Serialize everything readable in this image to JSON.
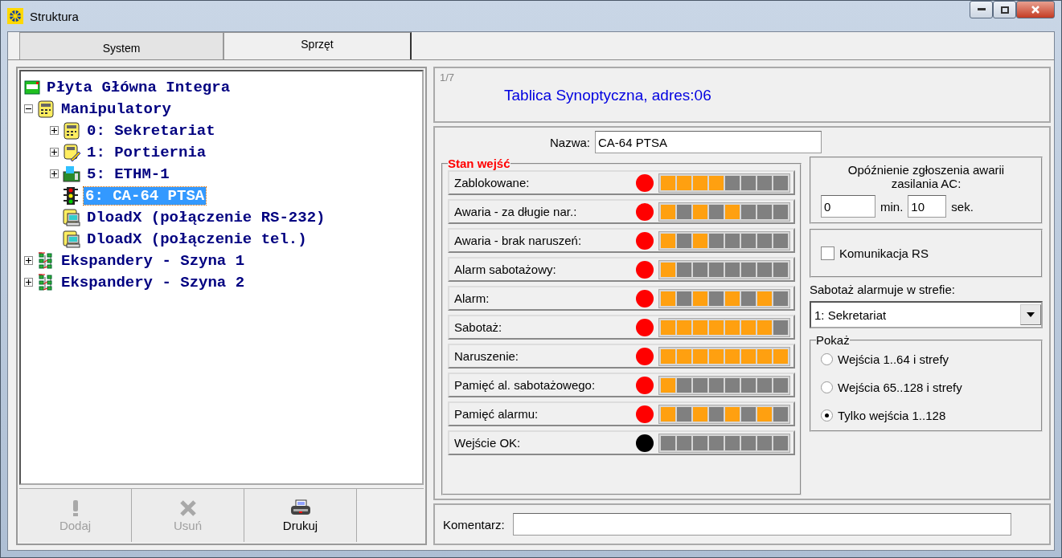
{
  "window": {
    "title": "Struktura"
  },
  "tabs": [
    {
      "label": "System",
      "selected": false
    },
    {
      "label": "Sprzęt",
      "selected": true
    }
  ],
  "tree": [
    {
      "label": "Płyta Główna Integra",
      "kind": "board",
      "selected": false
    },
    {
      "label": "Manipulatory",
      "kind": "keypad",
      "expanded": true,
      "selected": false,
      "children": [
        {
          "label": "0: Sekretariat",
          "kind": "keypad",
          "expanded": false,
          "selected": false
        },
        {
          "label": "1: Portiernia",
          "kind": "keypad-pen",
          "expanded": false,
          "selected": false
        },
        {
          "label": "5: ETHM-1",
          "kind": "network",
          "expanded": false,
          "selected": false
        },
        {
          "label": "6: CA-64 PTSA",
          "kind": "traffic",
          "selected": true
        },
        {
          "label": "DloadX (połączenie RS-232)",
          "kind": "computer",
          "selected": false
        },
        {
          "label": "DloadX (połączenie tel.)",
          "kind": "computer",
          "selected": false
        }
      ]
    },
    {
      "label": "Ekspandery - Szyna 1",
      "kind": "bus",
      "expanded": false,
      "selected": false
    },
    {
      "label": "Ekspandery - Szyna 2",
      "kind": "bus",
      "expanded": false,
      "selected": false
    }
  ],
  "buttons": [
    {
      "label": "Dodaj",
      "kind": "exclaim",
      "disabled": true
    },
    {
      "label": "Usuń",
      "kind": "cross",
      "disabled": true
    },
    {
      "label": "Drukuj",
      "kind": "printer",
      "disabled": false
    }
  ],
  "header": {
    "counter": "1/7",
    "title": "Tablica Synoptyczna, adres:06"
  },
  "name": {
    "label": "Nazwa:",
    "value": "CA-64 PTSA"
  },
  "inputs_group": {
    "title": "Stan wejść"
  },
  "inputs": [
    {
      "label": "Zablokowane:",
      "color": "#ff0000",
      "segments": [
        true,
        true,
        true,
        true,
        false,
        false,
        false,
        false
      ]
    },
    {
      "label": "Awaria - za długie nar.:",
      "color": "#ff0000",
      "segments": [
        true,
        false,
        true,
        false,
        true,
        false,
        false,
        false
      ]
    },
    {
      "label": "Awaria - brak naruszeń:",
      "color": "#ff0000",
      "segments": [
        true,
        false,
        true,
        false,
        false,
        false,
        false,
        false
      ]
    },
    {
      "label": "Alarm sabotażowy:",
      "color": "#ff0000",
      "segments": [
        true,
        false,
        false,
        false,
        false,
        false,
        false,
        false
      ]
    },
    {
      "label": "Alarm:",
      "color": "#ff0000",
      "segments": [
        true,
        false,
        true,
        false,
        true,
        false,
        true,
        false
      ]
    },
    {
      "label": "Sabotaż:",
      "color": "#ff0000",
      "segments": [
        true,
        true,
        true,
        true,
        true,
        true,
        true,
        false
      ]
    },
    {
      "label": "Naruszenie:",
      "color": "#ff0000",
      "segments": [
        true,
        true,
        true,
        true,
        true,
        true,
        true,
        true
      ]
    },
    {
      "label": "Pamięć al. sabotażowego:",
      "color": "#ff0000",
      "segments": [
        true,
        false,
        false,
        false,
        false,
        false,
        false,
        false
      ]
    },
    {
      "label": "Pamięć alarmu:",
      "color": "#ff0000",
      "segments": [
        true,
        false,
        true,
        false,
        true,
        false,
        true,
        false
      ]
    },
    {
      "label": "Wejście OK:",
      "color": "#000000",
      "segments": [
        false,
        false,
        false,
        false,
        false,
        false,
        false,
        false
      ]
    }
  ],
  "delay": {
    "title": "Opóźnienie zgłoszenia awarii zasilania AC:",
    "minutes": "0",
    "minutes_unit": "min.",
    "seconds": "10",
    "seconds_unit": "sek."
  },
  "rs": {
    "label": "Komunikacja RS",
    "checked": false
  },
  "tamper_zone": {
    "label": "Sabotaż alarmuje w strefie:",
    "value": "1: Sekretariat"
  },
  "show": {
    "title": "Pokaż",
    "options": [
      {
        "label": "Wejścia 1..64 i strefy",
        "selected": false
      },
      {
        "label": "Wejścia 65..128 i strefy",
        "selected": false
      },
      {
        "label": "Tylko wejścia 1..128",
        "selected": true
      }
    ]
  },
  "comment": {
    "label": "Komentarz:"
  }
}
